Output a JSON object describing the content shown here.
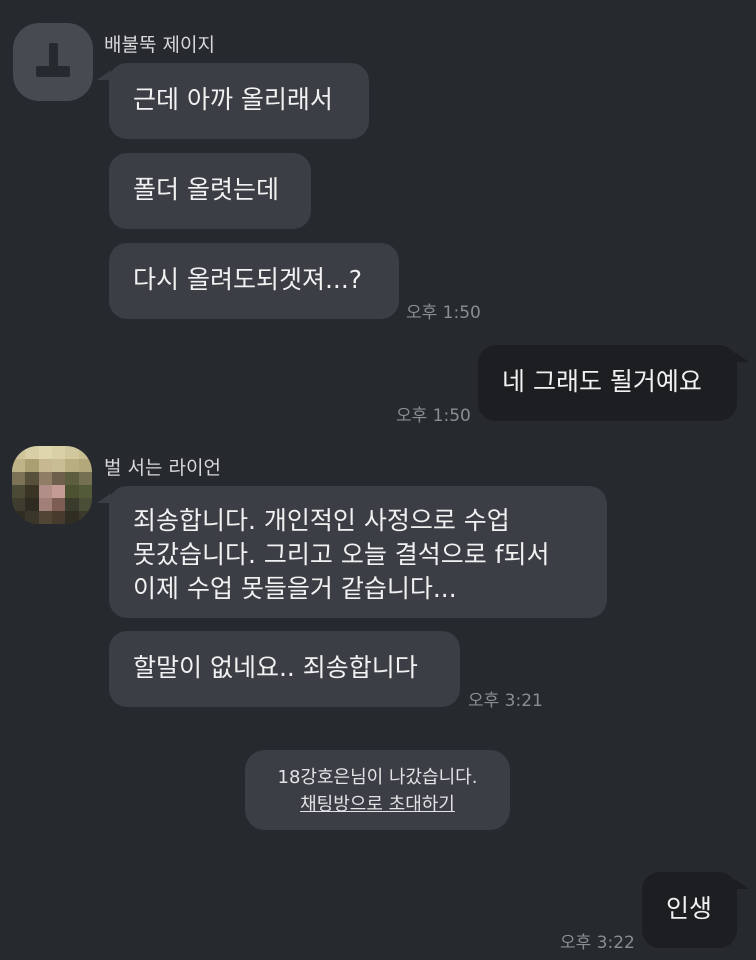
{
  "senders": {
    "first": "배불뚝 제이지",
    "second": "벌 서는 라이언"
  },
  "messages": {
    "m1": "근데 아까 올리래서",
    "m2": "폴더 올렷는데",
    "m3": "다시 올려도되겟져...?",
    "m3_time": "오후 1:50",
    "m4": "네 그래도 될거예요",
    "m4_time": "오후 1:50",
    "m5_line1": "죄송합니다. 개인적인 사정으로 수업",
    "m5_line2": "못갔습니다. 그리고 오늘 결석으로 f되서",
    "m5_line3": "이제 수업 못들을거 같습니다...",
    "m6": "할말이 없네요.. 죄송합니다",
    "m6_time": "오후 3:21",
    "m7": "인생",
    "m7_time": "오후 3:22"
  },
  "notice": {
    "text": "18강호은님이 나갔습니다.",
    "invite_label": "채팅방으로 초대하기"
  },
  "colors": {
    "background": "#26292e",
    "incoming_bubble": "#3b3e44",
    "outgoing_bubble": "#1c1e22",
    "timestamp": "#8a8d92"
  }
}
